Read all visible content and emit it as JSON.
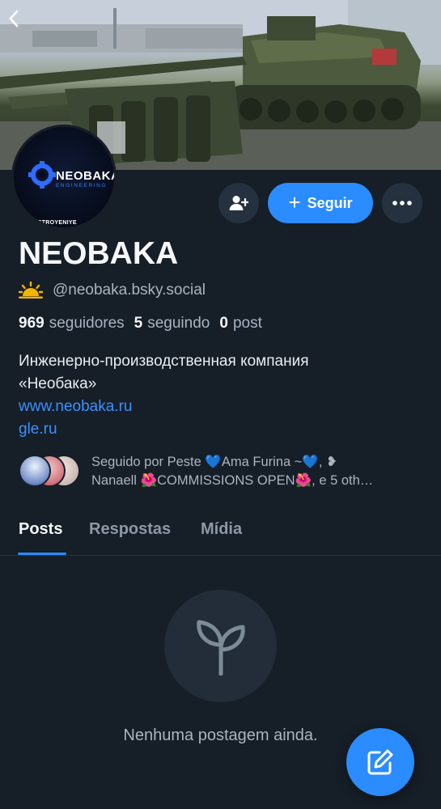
{
  "header": {
    "back_icon": "chevron-left-icon"
  },
  "profile": {
    "avatar_brand": "NEOBAKA",
    "avatar_sub": "ENGINEERING",
    "avatar_bottom": "OSTROYENIYE",
    "display_name": "NEOBAKA",
    "handle_emoji": "🌥",
    "handle": "@neobaka.bsky.social",
    "stats": {
      "followers_count": "969",
      "followers_label": "seguidores",
      "following_count": "5",
      "following_label": "seguindo",
      "posts_count": "0",
      "posts_label": "post"
    },
    "bio_line1": "Инженерно-производственная компания",
    "bio_line2": "«Необака»",
    "link1": "www.neobaka.ru",
    "link2": "gle.ru"
  },
  "actions": {
    "follow_label": "Seguir",
    "follow_icon": "plus-icon",
    "add_user_icon": "person-add-icon",
    "more_icon": "ellipsis-icon"
  },
  "followed_by": {
    "line1": "Seguido por Peste 💙Ama Furina ~💙, ❥",
    "line2": "Nanaell 🌺COMMISSIONS OPEN🌺, e 5 oth…"
  },
  "tabs": [
    {
      "label": "Posts",
      "active": true
    },
    {
      "label": "Respostas",
      "active": false
    },
    {
      "label": "Mídia",
      "active": false
    }
  ],
  "empty_state": {
    "icon": "sprout-icon",
    "text": "Nenhuma postagem ainda."
  },
  "fab": {
    "icon": "compose-icon"
  },
  "colors": {
    "background": "#161e27",
    "accent": "#2a8cff",
    "muted_text": "#aab4c0",
    "button_bg": "#263140"
  }
}
